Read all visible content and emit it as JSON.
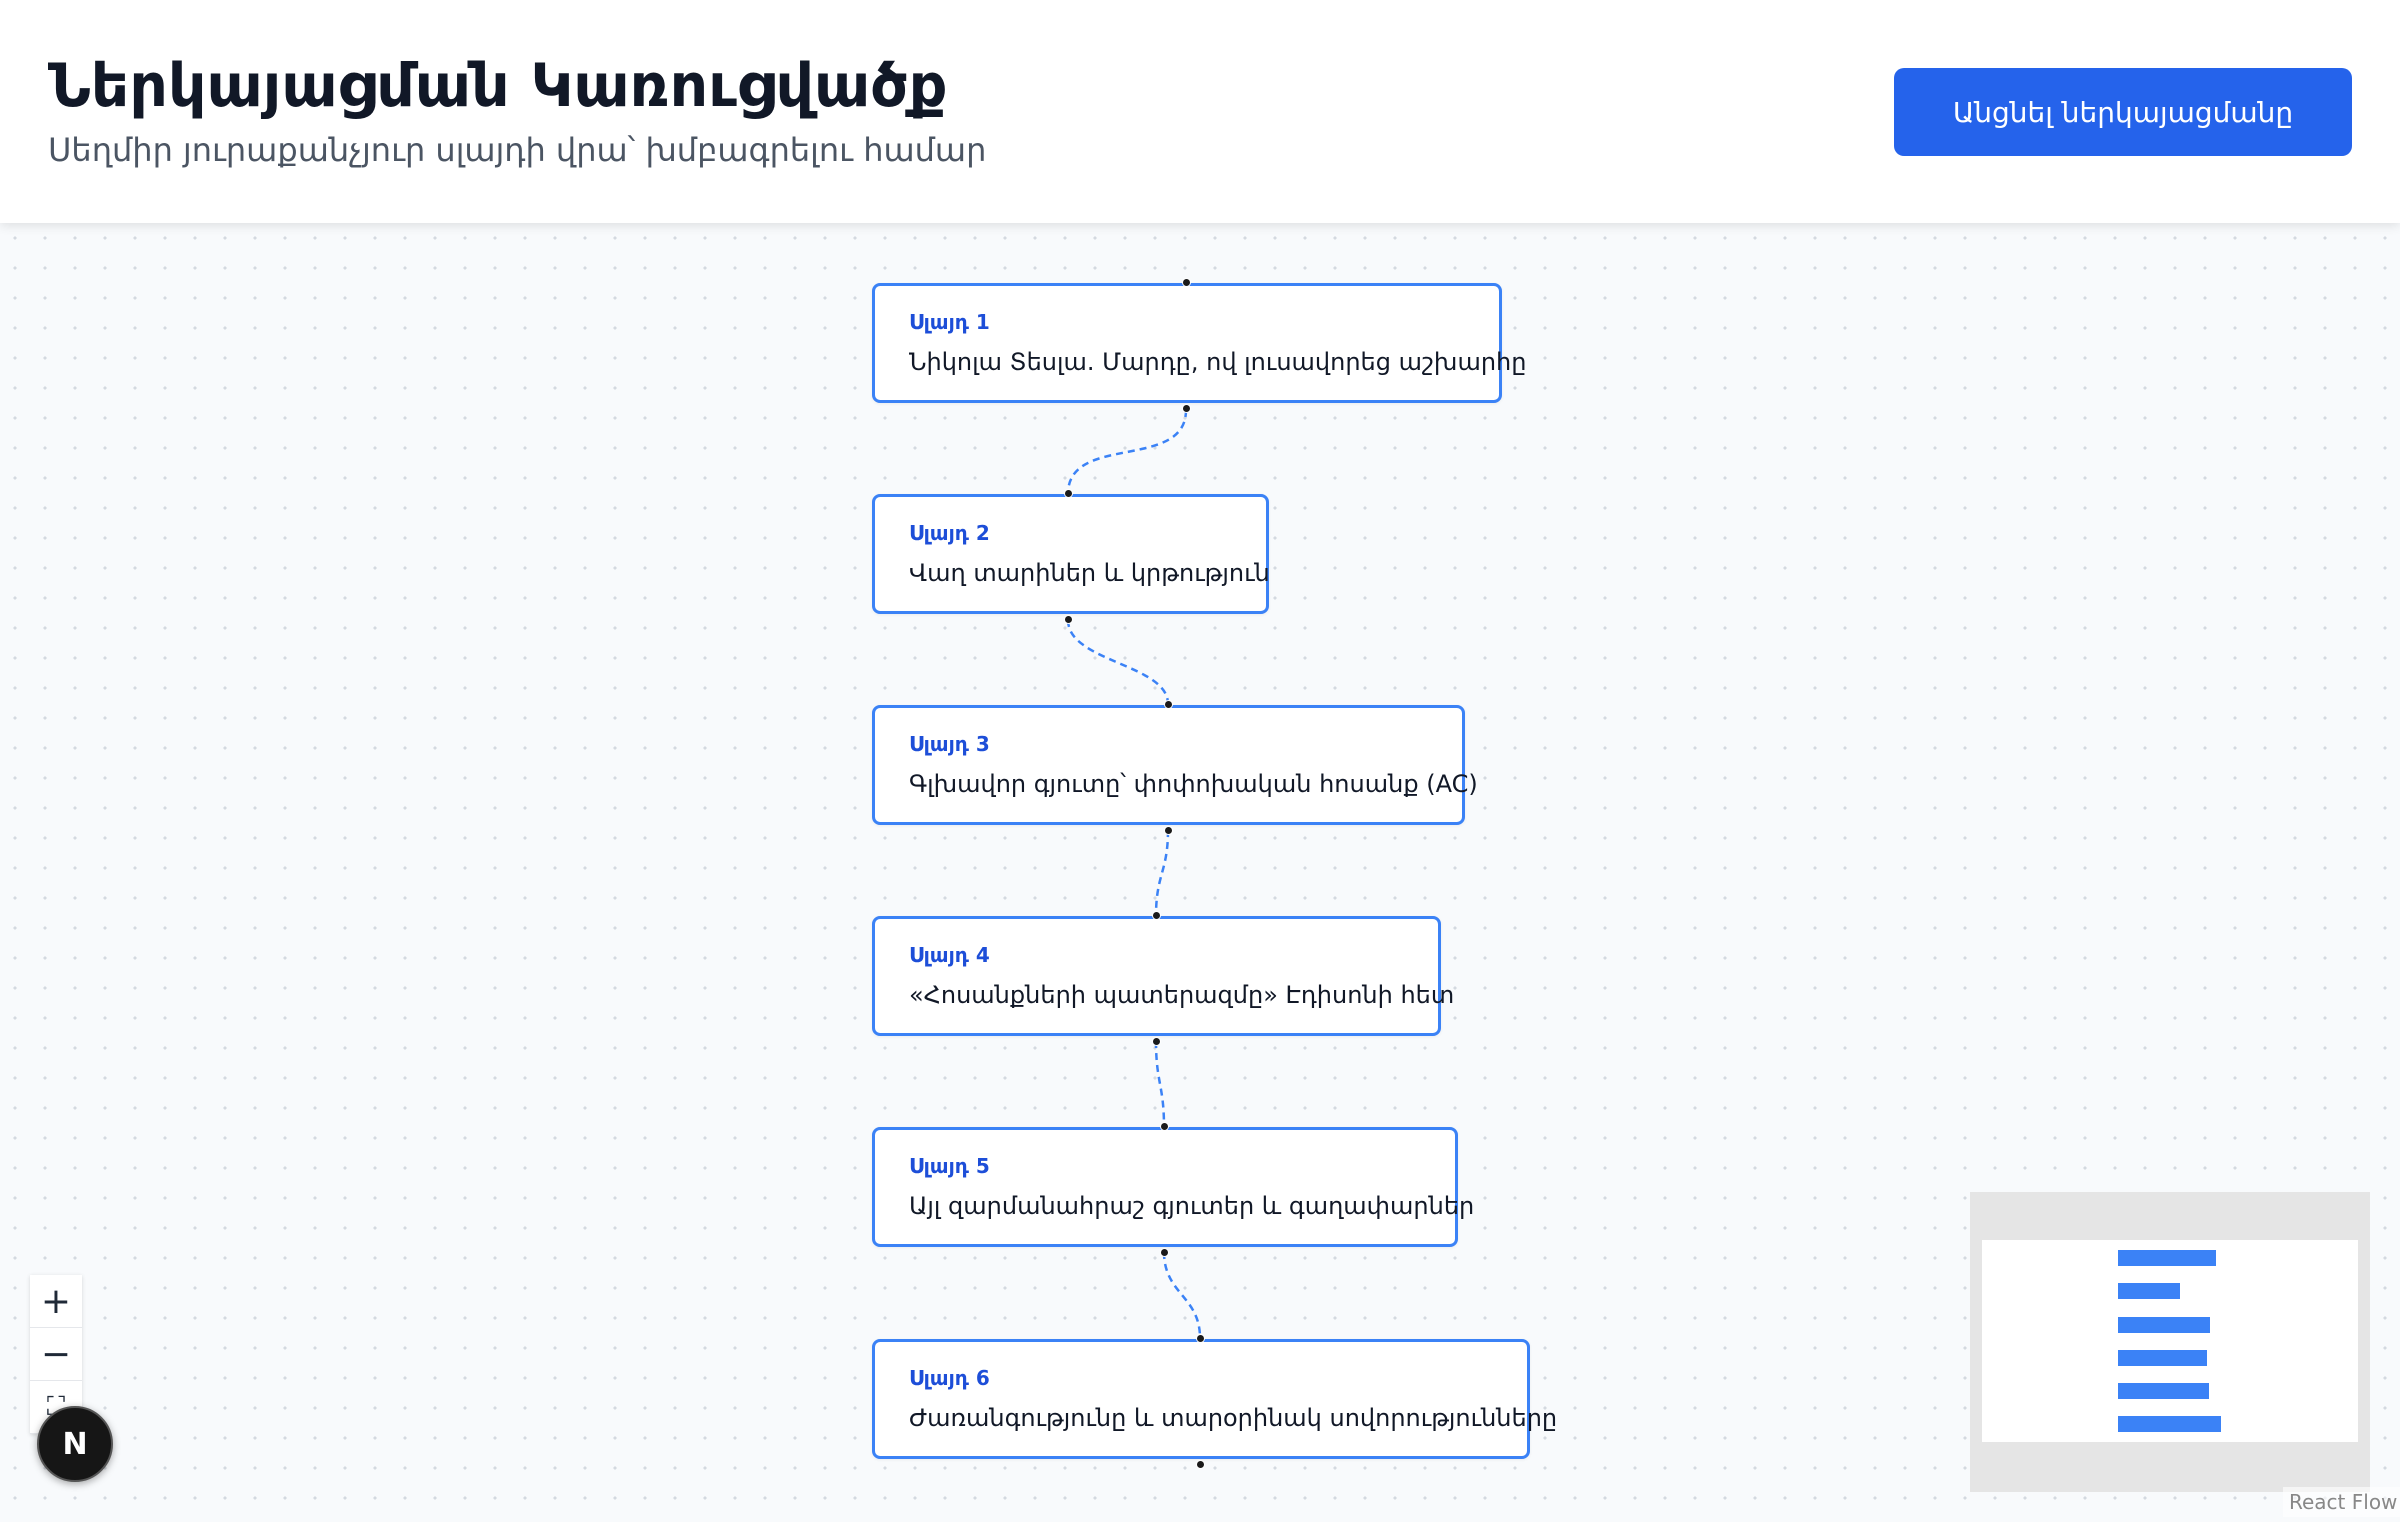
{
  "header": {
    "title": "Ներկայացման Կառուցվածք",
    "subtitle": "Սեղմիր յուրաքանչյուր սլայդի վրա՝ խմբագրելու համար",
    "present_button": "Անցնել ներկայացմանը"
  },
  "slides": [
    {
      "label": "Սլայդ 1",
      "title": "Նիկոլա Տեսլա. Մարդը, ով լուսավորեց աշխարհը"
    },
    {
      "label": "Սլայդ 2",
      "title": "Վաղ տարիներ և կրթություն"
    },
    {
      "label": "Սլայդ 3",
      "title": "Գլխավոր գյուտը՝ փոփոխական հոսանք (AC)"
    },
    {
      "label": "Սլայդ 4",
      "title": "«Հոսանքների պատերազմը» Էդիսոնի հետ"
    },
    {
      "label": "Սլայդ 5",
      "title": "Այլ զարմանահրաշ գյուտեր և գաղափարներ"
    },
    {
      "label": "Սլայդ 6",
      "title": "Ժառանգությունը և տարօրինակ սովորությունները"
    }
  ],
  "controls": {
    "zoom_in": "+",
    "zoom_out": "−",
    "fit_view": "⛶"
  },
  "badge": {
    "letter": "N"
  },
  "attribution": "React Flow",
  "colors": {
    "accent": "#2563eb",
    "node_border": "#3b82f6",
    "edge": "#3b82f6"
  },
  "icons": {
    "zoom_in": "plus-icon",
    "zoom_out": "minus-icon",
    "fit_view": "fit-view-icon",
    "badge": "nextjs-logo-icon"
  }
}
